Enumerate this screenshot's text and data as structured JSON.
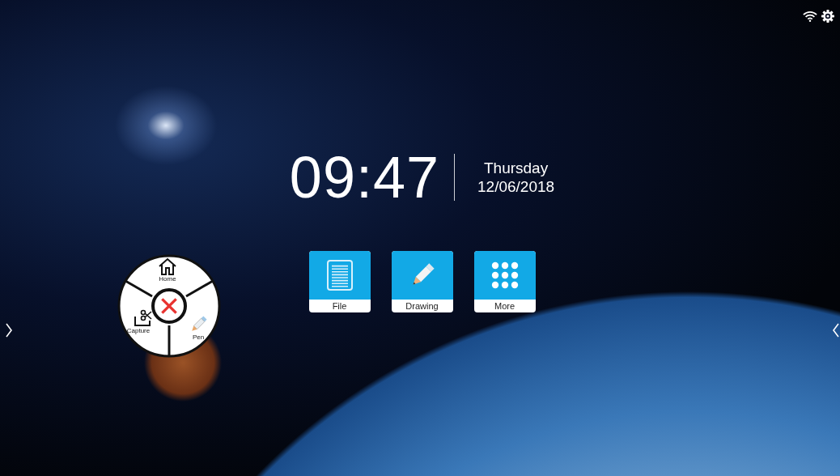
{
  "clock": {
    "time": "09:47",
    "weekday": "Thursday",
    "date": "12/06/2018"
  },
  "apps": [
    {
      "label": "File",
      "kind": "file"
    },
    {
      "label": "Drawing",
      "kind": "drawing"
    },
    {
      "label": "More",
      "kind": "more"
    }
  ],
  "radial_menu": {
    "items": [
      {
        "label": "Home",
        "kind": "home"
      },
      {
        "label": "Capture",
        "kind": "capture"
      },
      {
        "label": "Pen",
        "kind": "pen"
      }
    ]
  }
}
